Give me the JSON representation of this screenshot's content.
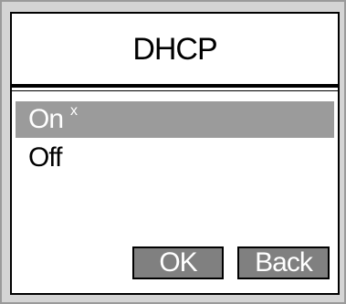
{
  "screen": {
    "title": "DHCP"
  },
  "options": [
    {
      "label": "On",
      "marker": "x",
      "selected": true
    },
    {
      "label": "Off",
      "marker": "",
      "selected": false
    }
  ],
  "buttons": {
    "ok_label": "OK",
    "back_label": "Back"
  },
  "colors": {
    "selection": "#9b9b9b",
    "button": "#808080",
    "bezel": "#d4d4d4"
  }
}
